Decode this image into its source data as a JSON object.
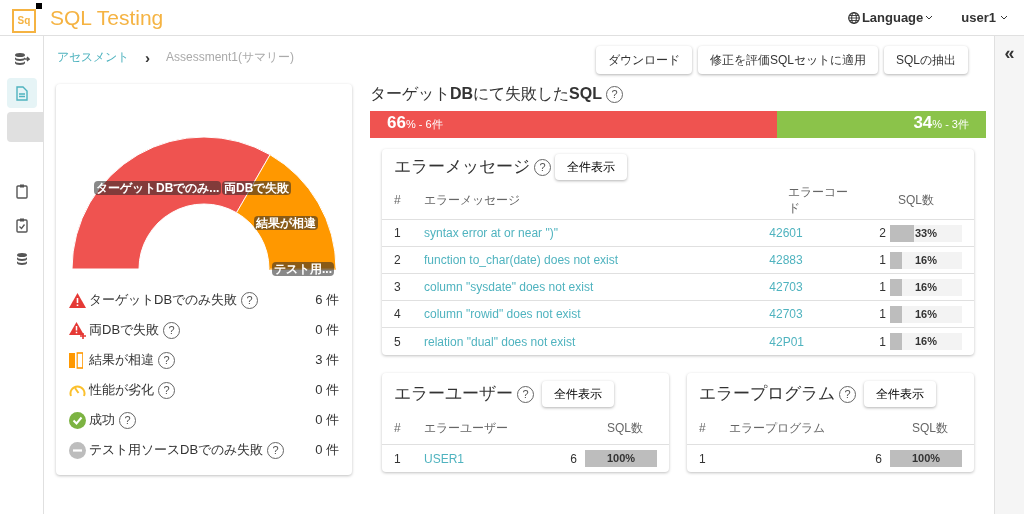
{
  "header": {
    "logo_mark": "Sq",
    "title": "SQL Testing",
    "language": "Language",
    "user": "user1"
  },
  "sidebar": {
    "items": [
      {
        "kind": "db-arrow",
        "selected": false
      },
      {
        "kind": "doc",
        "selected": true
      },
      {
        "kind": "blank",
        "selected": false
      },
      {
        "kind": "clipboard",
        "selected": false
      },
      {
        "kind": "clipboard-check",
        "selected": false
      },
      {
        "kind": "database",
        "selected": false
      }
    ]
  },
  "breadcrumb": [
    {
      "label": "アセスメント",
      "kind": "link"
    },
    {
      "label": "Assessment1(サマリー)",
      "kind": "current"
    }
  ],
  "breadcrumb_separator": "›",
  "actions": [
    "ダウンロード",
    "修正を評価SQLセットに適用",
    "SQLの抽出"
  ],
  "collapse_icon": "«",
  "summary": {
    "chart_data": {
      "type": "donut",
      "categories": [
        "ターゲットDBでのみ...",
        "両DBで失敗",
        "結果が相違",
        "テスト用..."
      ],
      "colors": [
        "#ef5350",
        "#ef5350",
        "#ff9800",
        "#ff9800"
      ],
      "values": [
        66.67,
        0,
        33.33,
        0
      ]
    },
    "legend": [
      {
        "kind": "warning",
        "label": "ターゲットDBでのみ失敗",
        "count": "6 件"
      },
      {
        "kind": "warning-plus",
        "label": "両DBで失敗",
        "count": "0 件"
      },
      {
        "kind": "diff",
        "label": "結果が相違",
        "count": "3 件"
      },
      {
        "kind": "gauge",
        "label": "性能が劣化",
        "count": "0 件"
      },
      {
        "kind": "success",
        "label": "成功",
        "count": "0 件"
      },
      {
        "kind": "minus",
        "label": "テスト用ソースDBでのみ失敗",
        "count": "0 件"
      }
    ]
  },
  "failed": {
    "title_parts": [
      "ターゲット",
      "DB",
      "にて失敗した",
      "SQL"
    ],
    "help": "?",
    "bar": [
      {
        "percent": "66",
        "unit": "%",
        "detail": " - 6件",
        "level": 0.66,
        "color": "#ef5350"
      },
      {
        "percent": "34",
        "unit": "%",
        "detail": " - 3件",
        "color": "#8bc34a"
      }
    ]
  },
  "error_messages": {
    "title": "エラーメッセージ",
    "button": "全件表示",
    "columns": [
      "#",
      "エラーメッセージ",
      "エラーコード",
      "SQL数"
    ],
    "rows": [
      {
        "no": "1",
        "message": "syntax error at or near \")\"",
        "code": "42601",
        "count": "2",
        "level": 0.33,
        "percent": "33%"
      },
      {
        "no": "2",
        "message": "function to_char(date) does not exist",
        "code": "42883",
        "count": "1",
        "level": 0.16,
        "percent": "16%"
      },
      {
        "no": "3",
        "message": "column \"sysdate\" does not exist",
        "code": "42703",
        "count": "1",
        "level": 0.16,
        "percent": "16%"
      },
      {
        "no": "4",
        "message": "column \"rowid\" does not exist",
        "code": "42703",
        "count": "1",
        "level": 0.16,
        "percent": "16%"
      },
      {
        "no": "5",
        "message": "relation \"dual\" does not exist",
        "code": "42P01",
        "count": "1",
        "level": 0.16,
        "percent": "16%"
      }
    ]
  },
  "error_users": {
    "title": "エラーユーザー",
    "button": "全件表示",
    "columns": [
      "#",
      "エラーユーザー",
      "SQL数"
    ],
    "rows": [
      {
        "no": "1",
        "name": "USER1",
        "count": "6",
        "level": 1,
        "percent": "100%"
      }
    ]
  },
  "error_programs": {
    "title": "エラープログラム",
    "button": "全件表示",
    "columns": [
      "#",
      "エラープログラム",
      "SQL数"
    ],
    "rows": [
      {
        "no": "1",
        "count": "6",
        "level": 1,
        "percent": "100%"
      }
    ]
  }
}
